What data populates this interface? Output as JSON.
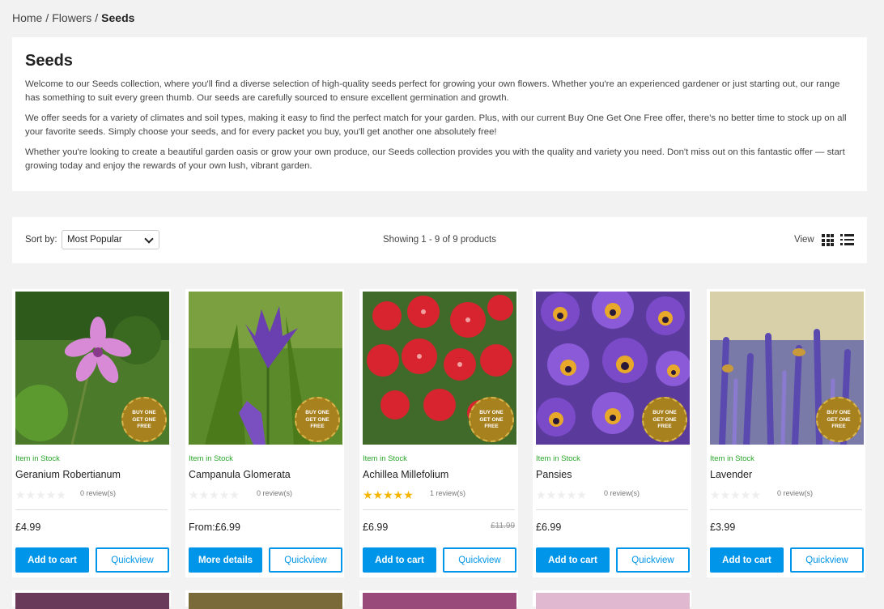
{
  "breadcrumb": {
    "home": "Home",
    "flowers": "Flowers",
    "current": "Seeds",
    "separator": "/"
  },
  "intro": {
    "title": "Seeds",
    "paragraphs": [
      "Welcome to our Seeds collection, where you'll find a diverse selection of high-quality seeds perfect for growing your own flowers. Whether you're an experienced gardener or just starting out, our range has something to suit every green thumb. Our seeds are carefully sourced to ensure excellent germination and growth.",
      "We offer seeds for a variety of climates and soil types, making it easy to find the perfect match for your garden. Plus, with our current Buy One Get One Free offer, there's no better time to stock up on all your favorite seeds. Simply choose your seeds, and for every packet you buy, you'll get another one absolutely free!",
      "Whether you're looking to create a beautiful garden oasis or grow your own produce, our Seeds collection provides you with the quality and variety you need. Don't miss out on this fantastic offer — start growing today and enjoy the rewards of your own lush, vibrant garden."
    ]
  },
  "toolbar": {
    "sort_label": "Sort by:",
    "sort_value": "Most Popular",
    "showing": "Showing 1 - 9 of 9 products",
    "view_label": "View"
  },
  "badge": {
    "line1": "BUY ONE",
    "line2": "GET ONE",
    "line3": "FREE"
  },
  "products": [
    {
      "stock": "Item in Stock",
      "name": "Geranium Robertianum",
      "reviews": "0 review(s)",
      "rating": 0,
      "price": "£4.99",
      "old_price": "",
      "primary_button": "Add to cart",
      "secondary_button": "Quickview"
    },
    {
      "stock": "Item in Stock",
      "name": "Campanula Glomerata",
      "reviews": "0 review(s)",
      "rating": 0,
      "price": "From:£6.99",
      "old_price": "",
      "primary_button": "More details",
      "secondary_button": "Quickview"
    },
    {
      "stock": "Item in Stock",
      "name": "Achillea Millefolium",
      "reviews": "1 review(s)",
      "rating": 5,
      "price": "£6.99",
      "old_price": "£11.99",
      "primary_button": "Add to cart",
      "secondary_button": "Quickview"
    },
    {
      "stock": "Item in Stock",
      "name": "Pansies",
      "reviews": "0 review(s)",
      "rating": 0,
      "price": "£6.99",
      "old_price": "",
      "primary_button": "Add to cart",
      "secondary_button": "Quickview"
    },
    {
      "stock": "Item in Stock",
      "name": "Lavender",
      "reviews": "0 review(s)",
      "rating": 0,
      "price": "£3.99",
      "old_price": "",
      "primary_button": "Add to cart",
      "secondary_button": "Quickview"
    }
  ],
  "colors": {
    "accent": "#0095e8",
    "stock_green": "#2aa52a",
    "star": "#f5b400",
    "badge_gold": "#a8811f"
  }
}
